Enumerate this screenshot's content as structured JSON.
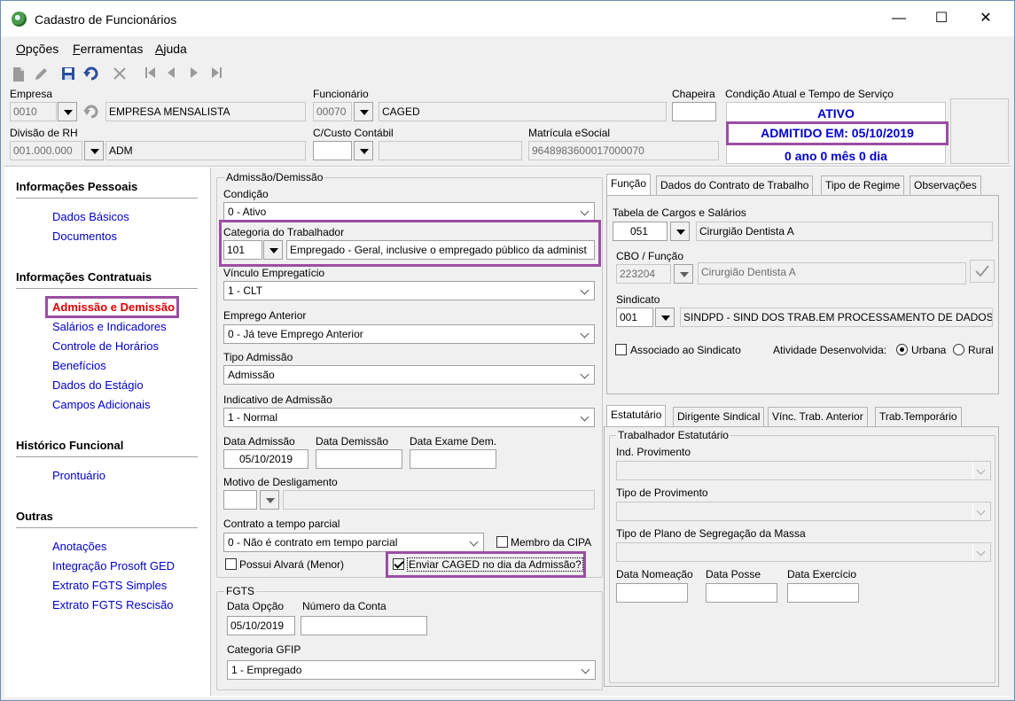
{
  "window": {
    "title": "Cadastro de Funcionários",
    "minimize": "—",
    "maximize": "☐",
    "close": "✕"
  },
  "menu": [
    {
      "label": "Opções",
      "underline": "O",
      "rest": "pções"
    },
    {
      "label": "Ferramentas",
      "underline": "F",
      "rest": "erramentas"
    },
    {
      "label": "Ajuda",
      "underline": "A",
      "rest": "juda"
    }
  ],
  "header": {
    "empresa_label": "Empresa",
    "empresa_code": "0010",
    "empresa_name": "EMPRESA MENSALISTA",
    "funcionario_label": "Funcionário",
    "funcionario_code": "00070",
    "funcionario_name": "CAGED",
    "chapeira_label": "Chapeira",
    "chapeira_value": "",
    "condicao_label": "Condição Atual e Tempo de Serviço",
    "status": "ATIVO",
    "admitido": "ADMITIDO EM: 05/10/2019",
    "tempo": "0 ano 0 mês 0 dia",
    "divisao_label": "Divisão de RH",
    "divisao_code": "001.000.000",
    "divisao_name": "ADM",
    "custo_label": "C/Custo Contábil",
    "matricula_label": "Matrícula eSocial",
    "matricula_value": "9648983600017000070"
  },
  "sidebar": {
    "sections": [
      {
        "title": "Informações Pessoais",
        "items": [
          "Dados Básicos",
          "Documentos"
        ]
      },
      {
        "title": "Informações Contratuais",
        "items": [
          "Admissão e Demissão",
          "Salários e Indicadores",
          "Controle de Horários",
          "Benefícios",
          "Dados do Estágio",
          "Campos Adicionais"
        ]
      },
      {
        "title": "Histórico Funcional",
        "items": [
          "Prontuário"
        ]
      },
      {
        "title": "Outras",
        "items": [
          "Anotações",
          "Integração Prosoft GED",
          "Extrato FGTS Simples",
          "Extrato FGTS Rescisão"
        ]
      }
    ]
  },
  "admissao": {
    "group_title": "Admissão/Demissão",
    "condicao_label": "Condição",
    "condicao_value": "0 - Ativo",
    "categoria_label": "Categoria do Trabalhador",
    "categoria_code": "101",
    "categoria_desc": "Empregado - Geral, inclusive o empregado público da administ",
    "vinculo_label": "Vínculo Empregatício",
    "vinculo_value": "1 - CLT",
    "emprego_label": "Emprego Anterior",
    "emprego_value": "0 - Já teve Emprego Anterior",
    "tipo_label": "Tipo Admissão",
    "tipo_value": "Admissão",
    "indicativo_label": "Indicativo de Admissão",
    "indicativo_value": "1 - Normal",
    "data_adm_label": "Data Admissão",
    "data_adm_value": "05/10/2019",
    "data_dem_label": "Data Demissão",
    "data_exame_label": "Data Exame Dem.",
    "motivo_label": "Motivo de Desligamento",
    "contrato_label": "Contrato a tempo parcial",
    "contrato_value": "0 - Não é contrato em tempo parcial",
    "membro_cipa": "Membro da CIPA",
    "possui_alvara": "Possui Alvará (Menor)",
    "enviar_caged": "Enviar CAGED no dia da Admissão?"
  },
  "fgts": {
    "group_title": "FGTS",
    "data_opcao_label": "Data Opção",
    "data_opcao_value": "05/10/2019",
    "numero_conta_label": "Número da Conta",
    "categoria_label": "Categoria GFIP",
    "categoria_value": "1 - Empregado"
  },
  "tabs_top": [
    "Função",
    "Dados do Contrato de Trabalho",
    "Tipo de Regime",
    "Observações"
  ],
  "funcao": {
    "tabela_label": "Tabela de Cargos e Salários",
    "tabela_code": "051",
    "tabela_name": "Cirurgião Dentista A",
    "cbo_label": "CBO / Função",
    "cbo_code": "223204",
    "cbo_name": "Cirurgião Dentista A",
    "sindicato_label": "Sindicato",
    "sindicato_code": "001",
    "sindicato_name": "SINDPD - SIND DOS TRAB.EM PROCESSAMENTO DE DADOS ES",
    "associado_label": "Associado ao Sindicato",
    "atividade_label": "Atividade Desenvolvida:",
    "urbana": "Urbana",
    "rural": "Rural"
  },
  "tabs_bottom": [
    "Estatutário",
    "Dirigente Sindical",
    "Vínc. Trab. Anterior",
    "Trab.Temporário"
  ],
  "estatutario": {
    "group_title": "Trabalhador Estatutário",
    "ind_prov_label": "Ind. Provimento",
    "tipo_prov_label": "Tipo de Provimento",
    "tipo_plano_label": "Tipo de Plano de Segregação da Massa",
    "data_nomeacao_label": "Data Nomeação",
    "data_posse_label": "Data Posse",
    "data_exercicio_label": "Data Exercício"
  },
  "colors": {
    "highlight": "#9b4ea3",
    "link": "#0000cc",
    "active_link": "#e00000"
  }
}
